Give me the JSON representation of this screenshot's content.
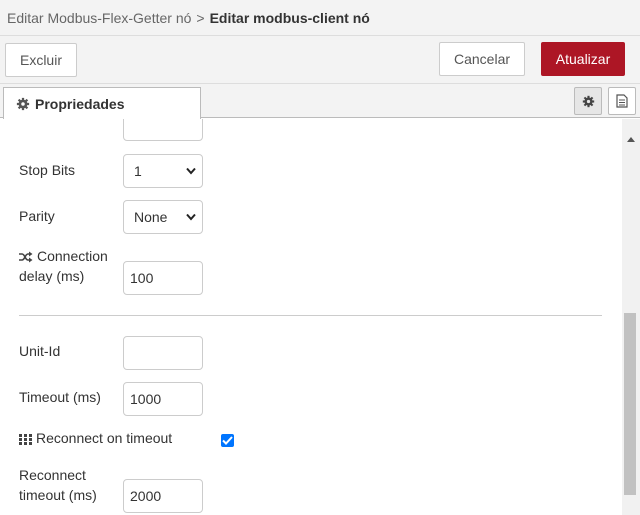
{
  "header": {
    "parent": "Editar Modbus-Flex-Getter nó",
    "separator": ">",
    "current": "Editar modbus-client nó"
  },
  "toolbar": {
    "delete_label": "Excluir",
    "cancel_label": "Cancelar",
    "update_label": "Atualizar",
    "accent_color": "#ad1625"
  },
  "tabs": {
    "properties_label": "Propriedades"
  },
  "form": {
    "stop_bits_label": "Stop Bits",
    "stop_bits_value": "1",
    "parity_label": "Parity",
    "parity_value": "None",
    "connection_delay_label_1": "Connection",
    "connection_delay_label_2": "delay (ms)",
    "connection_delay_value": "100",
    "unit_id_label": "Unit-Id",
    "unit_id_value": "",
    "timeout_label": "Timeout (ms)",
    "timeout_value": "1000",
    "reconnect_on_timeout_label": "Reconnect on timeout",
    "reconnect_on_timeout_checked": true,
    "reconnect_timeout_label_1": "Reconnect",
    "reconnect_timeout_label_2": "timeout (ms)",
    "reconnect_timeout_value": "2000"
  },
  "icons": {
    "tab_icon": "gear-icon",
    "settings_icon": "gear-icon",
    "info_icon": "document-icon",
    "connection_delay_icon": "shuffle-icon",
    "reconnect_icon": "grid-icon"
  }
}
